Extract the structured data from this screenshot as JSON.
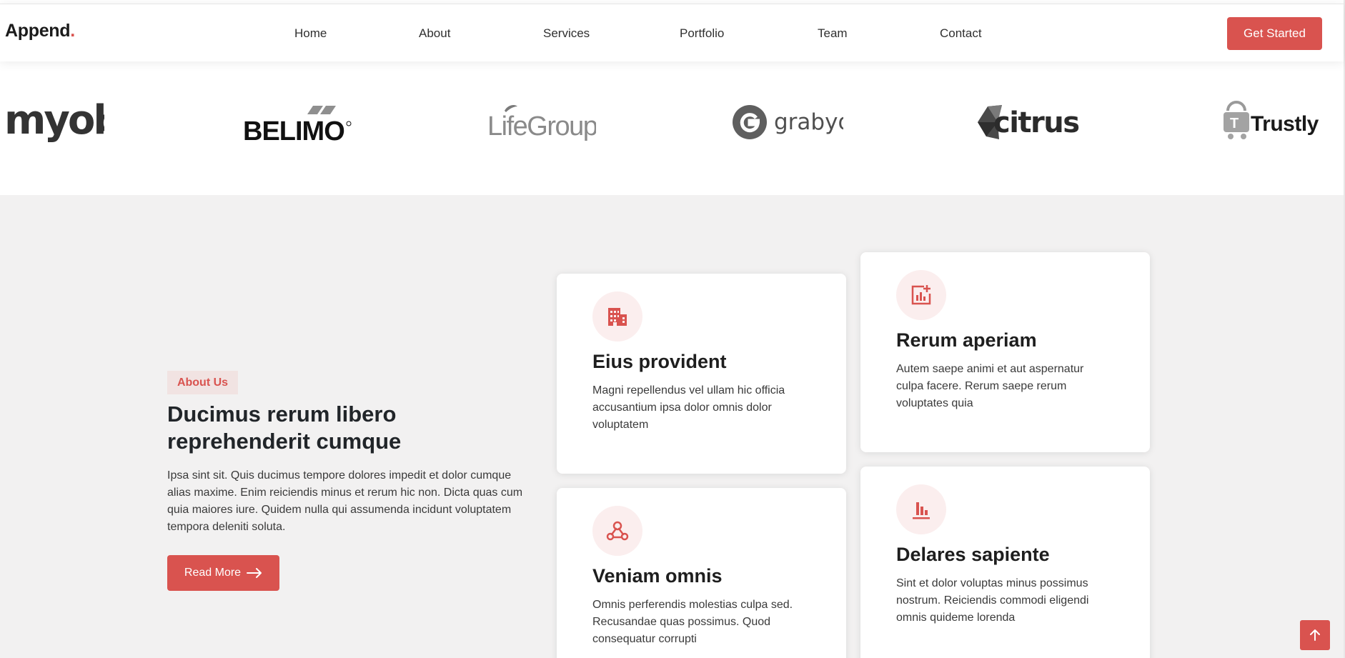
{
  "header": {
    "logo_text": "Append",
    "logo_dot": ".",
    "nav": [
      {
        "label": "Home"
      },
      {
        "label": "About"
      },
      {
        "label": "Services"
      },
      {
        "label": "Portfolio"
      },
      {
        "label": "Team"
      },
      {
        "label": "Contact"
      }
    ],
    "cta_label": "Get Started"
  },
  "clients": [
    {
      "name": "myob"
    },
    {
      "name": "BELIMO"
    },
    {
      "name": "LifeGroups"
    },
    {
      "name": "grabyo"
    },
    {
      "name": "citrus"
    },
    {
      "name": "Trustly"
    }
  ],
  "about": {
    "badge": "About Us",
    "title": "Ducimus rerum libero reprehenderit cumque",
    "text": "Ipsa sint sit. Quis ducimus tempore dolores impedit et dolor cumque alias maxime. Enim reiciendis minus et rerum hic non. Dicta quas cum quia maiores iure. Quidem nulla qui assumenda incidunt voluptatem tempora deleniti soluta.",
    "button_label": "Read More"
  },
  "features": [
    {
      "icon": "buildings-icon",
      "title": "Eius provident",
      "text": "Magni repellendus vel ullam hic officia accusantium ipsa dolor omnis dolor voluptatem"
    },
    {
      "icon": "graph-up-icon",
      "title": "Rerum aperiam",
      "text": "Autem saepe animi et aut aspernatur culpa facere. Rerum saepe rerum voluptates quia"
    },
    {
      "icon": "webhook-icon",
      "title": "Veniam omnis",
      "text": "Omnis perferendis molestias culpa sed. Recusandae quas possimus. Quod consequatur corrupti"
    },
    {
      "icon": "bar-chart-icon",
      "title": "Delares sapiente",
      "text": "Sint et dolor voluptas minus possimus nostrum. Reiciendis commodi eligendi omnis quideme lorenda"
    }
  ],
  "colors": {
    "accent": "#d9534f",
    "section_bg": "#f2f1f1",
    "icon_bg": "#fbeeee"
  }
}
